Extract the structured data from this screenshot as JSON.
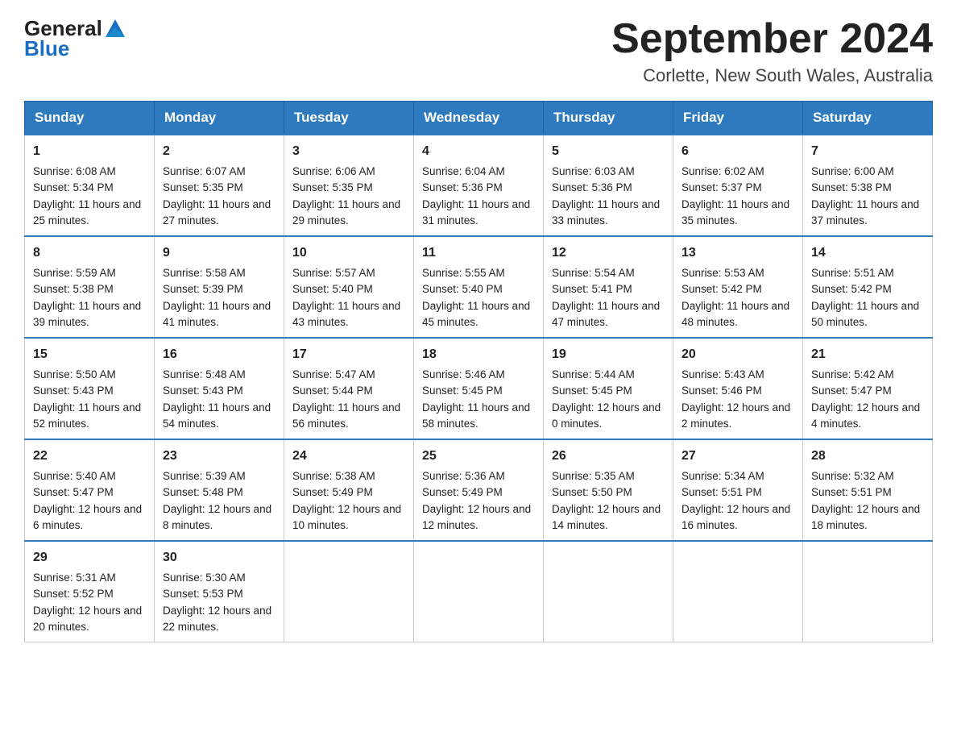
{
  "header": {
    "logo_general": "General",
    "logo_blue": "Blue",
    "title": "September 2024",
    "subtitle": "Corlette, New South Wales, Australia"
  },
  "days_of_week": [
    "Sunday",
    "Monday",
    "Tuesday",
    "Wednesday",
    "Thursday",
    "Friday",
    "Saturday"
  ],
  "weeks": [
    [
      {
        "day": "1",
        "sunrise": "6:08 AM",
        "sunset": "5:34 PM",
        "daylight": "11 hours and 25 minutes."
      },
      {
        "day": "2",
        "sunrise": "6:07 AM",
        "sunset": "5:35 PM",
        "daylight": "11 hours and 27 minutes."
      },
      {
        "day": "3",
        "sunrise": "6:06 AM",
        "sunset": "5:35 PM",
        "daylight": "11 hours and 29 minutes."
      },
      {
        "day": "4",
        "sunrise": "6:04 AM",
        "sunset": "5:36 PM",
        "daylight": "11 hours and 31 minutes."
      },
      {
        "day": "5",
        "sunrise": "6:03 AM",
        "sunset": "5:36 PM",
        "daylight": "11 hours and 33 minutes."
      },
      {
        "day": "6",
        "sunrise": "6:02 AM",
        "sunset": "5:37 PM",
        "daylight": "11 hours and 35 minutes."
      },
      {
        "day": "7",
        "sunrise": "6:00 AM",
        "sunset": "5:38 PM",
        "daylight": "11 hours and 37 minutes."
      }
    ],
    [
      {
        "day": "8",
        "sunrise": "5:59 AM",
        "sunset": "5:38 PM",
        "daylight": "11 hours and 39 minutes."
      },
      {
        "day": "9",
        "sunrise": "5:58 AM",
        "sunset": "5:39 PM",
        "daylight": "11 hours and 41 minutes."
      },
      {
        "day": "10",
        "sunrise": "5:57 AM",
        "sunset": "5:40 PM",
        "daylight": "11 hours and 43 minutes."
      },
      {
        "day": "11",
        "sunrise": "5:55 AM",
        "sunset": "5:40 PM",
        "daylight": "11 hours and 45 minutes."
      },
      {
        "day": "12",
        "sunrise": "5:54 AM",
        "sunset": "5:41 PM",
        "daylight": "11 hours and 47 minutes."
      },
      {
        "day": "13",
        "sunrise": "5:53 AM",
        "sunset": "5:42 PM",
        "daylight": "11 hours and 48 minutes."
      },
      {
        "day": "14",
        "sunrise": "5:51 AM",
        "sunset": "5:42 PM",
        "daylight": "11 hours and 50 minutes."
      }
    ],
    [
      {
        "day": "15",
        "sunrise": "5:50 AM",
        "sunset": "5:43 PM",
        "daylight": "11 hours and 52 minutes."
      },
      {
        "day": "16",
        "sunrise": "5:48 AM",
        "sunset": "5:43 PM",
        "daylight": "11 hours and 54 minutes."
      },
      {
        "day": "17",
        "sunrise": "5:47 AM",
        "sunset": "5:44 PM",
        "daylight": "11 hours and 56 minutes."
      },
      {
        "day": "18",
        "sunrise": "5:46 AM",
        "sunset": "5:45 PM",
        "daylight": "11 hours and 58 minutes."
      },
      {
        "day": "19",
        "sunrise": "5:44 AM",
        "sunset": "5:45 PM",
        "daylight": "12 hours and 0 minutes."
      },
      {
        "day": "20",
        "sunrise": "5:43 AM",
        "sunset": "5:46 PM",
        "daylight": "12 hours and 2 minutes."
      },
      {
        "day": "21",
        "sunrise": "5:42 AM",
        "sunset": "5:47 PM",
        "daylight": "12 hours and 4 minutes."
      }
    ],
    [
      {
        "day": "22",
        "sunrise": "5:40 AM",
        "sunset": "5:47 PM",
        "daylight": "12 hours and 6 minutes."
      },
      {
        "day": "23",
        "sunrise": "5:39 AM",
        "sunset": "5:48 PM",
        "daylight": "12 hours and 8 minutes."
      },
      {
        "day": "24",
        "sunrise": "5:38 AM",
        "sunset": "5:49 PM",
        "daylight": "12 hours and 10 minutes."
      },
      {
        "day": "25",
        "sunrise": "5:36 AM",
        "sunset": "5:49 PM",
        "daylight": "12 hours and 12 minutes."
      },
      {
        "day": "26",
        "sunrise": "5:35 AM",
        "sunset": "5:50 PM",
        "daylight": "12 hours and 14 minutes."
      },
      {
        "day": "27",
        "sunrise": "5:34 AM",
        "sunset": "5:51 PM",
        "daylight": "12 hours and 16 minutes."
      },
      {
        "day": "28",
        "sunrise": "5:32 AM",
        "sunset": "5:51 PM",
        "daylight": "12 hours and 18 minutes."
      }
    ],
    [
      {
        "day": "29",
        "sunrise": "5:31 AM",
        "sunset": "5:52 PM",
        "daylight": "12 hours and 20 minutes."
      },
      {
        "day": "30",
        "sunrise": "5:30 AM",
        "sunset": "5:53 PM",
        "daylight": "12 hours and 22 minutes."
      },
      null,
      null,
      null,
      null,
      null
    ]
  ],
  "labels": {
    "sunrise": "Sunrise:",
    "sunset": "Sunset:",
    "daylight": "Daylight:"
  }
}
